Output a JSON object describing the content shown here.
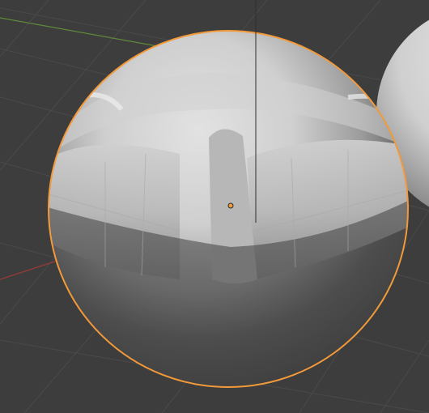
{
  "viewport": {
    "kind": "3d-viewport",
    "background_color": "#3d3d3d",
    "grid_color": "#4a4a4a",
    "x_axis_color": "#9a3b3b",
    "y_axis_color": "#5f8a3a",
    "selection_outline_color": "#f29a3a",
    "origin_dot_color": "#f29a3a"
  },
  "objects": [
    {
      "type": "sphere",
      "state": "selected",
      "shading": "solid-gray"
    },
    {
      "type": "sphere",
      "state": "unselected",
      "shading": "solid-gray",
      "partially_visible": true
    }
  ]
}
